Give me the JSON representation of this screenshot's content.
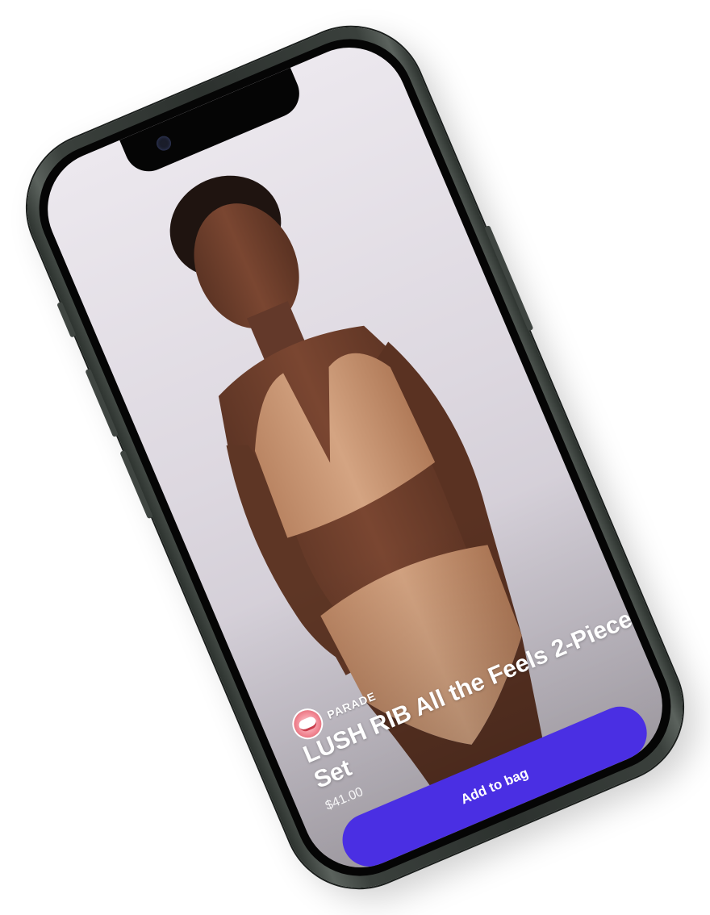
{
  "product": {
    "brand": "PARADE",
    "title": "LUSH RIB All the Feels 2-Piece Set",
    "price": "$41.00",
    "add_to_bag_label": "Add to bag"
  },
  "colors": {
    "button": "#4a2fe3",
    "phone_frame": "#2c312e",
    "screen_bg": "#ddd8e0",
    "garment": "#c89572",
    "brand_logo": "#f28a96"
  },
  "icons": {
    "brand_logo": "brand-logo-icon",
    "camera": "front-camera-icon"
  }
}
